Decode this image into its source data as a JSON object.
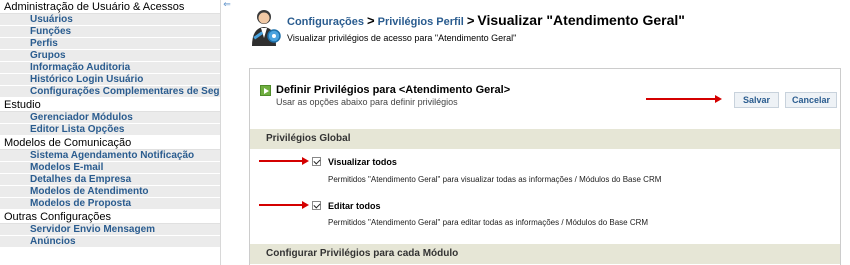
{
  "sidebar": {
    "sections": [
      {
        "title": "Administração de Usuário & Acessos",
        "items": [
          "Usuários",
          "Funções",
          "Perfis",
          "Grupos",
          "Informação Auditoria",
          "Histórico Login Usuário",
          "Configurações Complementares de Segurança"
        ]
      },
      {
        "title": "Estudio",
        "items": [
          "Gerenciador Módulos",
          "Editor Lista Opções"
        ]
      },
      {
        "title": "Modelos de Comunicação",
        "items": [
          "Sistema Agendamento Notificação",
          "Modelos E-mail",
          "Detalhes da Empresa",
          "Modelos de Atendimento",
          "Modelos de Proposta"
        ]
      },
      {
        "title": "Outras Configurações",
        "items": [
          "Servidor Envio Mensagem",
          "Anúncios"
        ]
      }
    ]
  },
  "collapse_icon": "double-left-arrow-icon",
  "header": {
    "icon": "user-settings-icon",
    "breadcrumb": [
      "Configurações",
      "Privilégios Perfil"
    ],
    "separator": ">",
    "title": "Visualizar \"Atendimento Geral\"",
    "subtitle": "Visualizar privilégios de acesso para \"Atendimento Geral\""
  },
  "panel": {
    "title": "Definir Privilégios para <Atendimento Geral>",
    "hint": "Usar as opções abaixo para definir privilégios",
    "save_label": "Salvar",
    "cancel_label": "Cancelar",
    "global_section": "Privilégios Global",
    "options": [
      {
        "label": "Visualizar todos",
        "checked": true,
        "desc": "Permitidos \"Atendimento Geral\" para visualizar todas as informações / Módulos do Base CRM"
      },
      {
        "label": "Editar todos",
        "checked": true,
        "desc": "Permitidos \"Atendimento Geral\" para editar todas as informações / Módulos do Base CRM"
      }
    ],
    "module_section": "Configurar Privilégios para cada Módulo"
  },
  "colors": {
    "link": "#2a5c8f",
    "arrow": "#d40000",
    "band": "#e6e6d6",
    "sidebar_item_bg": "#ebebeb"
  }
}
